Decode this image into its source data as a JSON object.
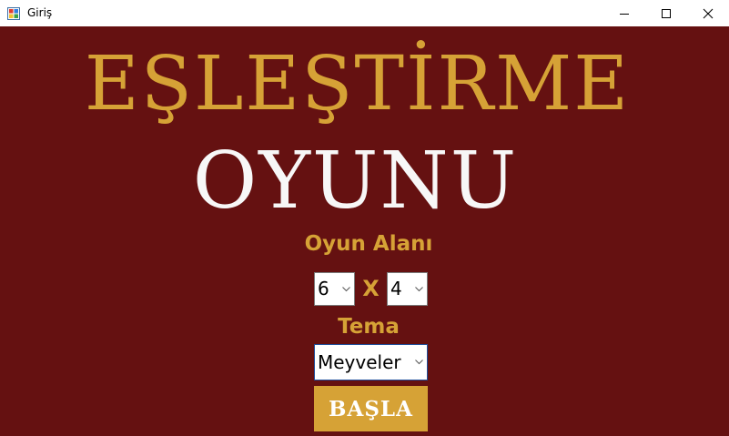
{
  "window": {
    "title": "Giriş",
    "icon": "winforms-app-icon",
    "controls": [
      "minimize-icon",
      "maximize-icon",
      "close-icon"
    ]
  },
  "game": {
    "title_line1": "EŞLEŞTİRME",
    "title_line2": "OYUNU"
  },
  "board": {
    "label": "Oyun Alanı",
    "rows_value": "6",
    "separator": "X",
    "cols_value": "4"
  },
  "theme": {
    "label": "Tema",
    "value": "Meyveler"
  },
  "start_button": {
    "label": "BAŞLA"
  },
  "colors": {
    "background": "#651111",
    "accent": "#d6a236",
    "title_white": "#f7f7f7"
  }
}
